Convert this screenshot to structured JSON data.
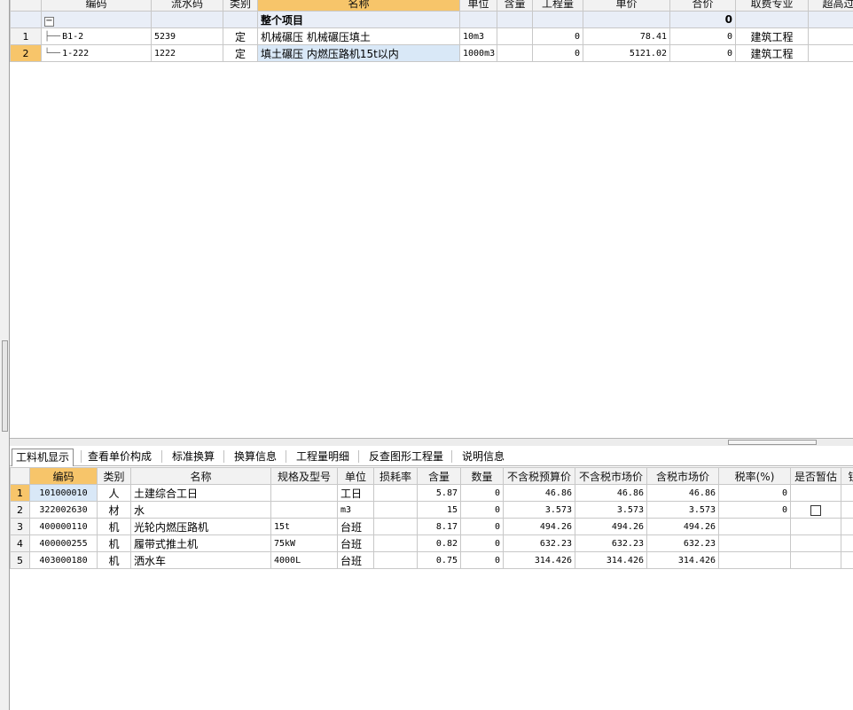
{
  "top_table": {
    "headers": [
      "编码",
      "流水码",
      "类别",
      "名称",
      "单位",
      "含量",
      "工程量",
      "单价",
      "合价",
      "取费专业",
      "超高过滤"
    ],
    "group_row": {
      "toggle": "−",
      "name": "整个项目",
      "total": "0"
    },
    "rows": [
      {
        "no": "1",
        "code": "B1-2",
        "serial": "5239",
        "type": "定",
        "name": "机械碾压 机械碾压填土",
        "unit": "10m3",
        "content": "",
        "qty": "0",
        "price": "78.41",
        "total": "0",
        "fee": "建筑工程"
      },
      {
        "no": "2",
        "code": "1-222",
        "serial": "1222",
        "type": "定",
        "name": "填土碾压 内燃压路机15t以内",
        "unit": "1000m3",
        "content": "",
        "qty": "0",
        "price": "5121.02",
        "total": "0",
        "fee": "建筑工程"
      }
    ]
  },
  "tabs": [
    "工料机显示",
    "查看单价构成",
    "标准换算",
    "换算信息",
    "工程量明细",
    "反查图形工程量",
    "说明信息"
  ],
  "bottom_table": {
    "headers": [
      "编码",
      "类别",
      "名称",
      "规格及型号",
      "单位",
      "损耗率",
      "含量",
      "数量",
      "不含税预算价",
      "不含税市场价",
      "含税市场价",
      "税率(%)",
      "是否暂估",
      "锁"
    ],
    "rows": [
      {
        "no": "1",
        "code": "101000010",
        "type": "人",
        "name": "土建综合工日",
        "spec": "",
        "unit": "工日",
        "loss": "",
        "content": "5.87",
        "qty": "0",
        "p1": "46.86",
        "p2": "46.86",
        "p3": "46.86",
        "tax": "0",
        "est": false
      },
      {
        "no": "2",
        "code": "322002630",
        "type": "材",
        "name": "水",
        "spec": "",
        "unit": "m3",
        "loss": "",
        "content": "15",
        "qty": "0",
        "p1": "3.573",
        "p2": "3.573",
        "p3": "3.573",
        "tax": "0",
        "est": true
      },
      {
        "no": "3",
        "code": "400000110",
        "type": "机",
        "name": "光轮内燃压路机",
        "spec": "15t",
        "unit": "台班",
        "loss": "",
        "content": "8.17",
        "qty": "0",
        "p1": "494.26",
        "p2": "494.26",
        "p3": "494.26",
        "tax": "",
        "est": false
      },
      {
        "no": "4",
        "code": "400000255",
        "type": "机",
        "name": "履带式推土机",
        "spec": "75kW",
        "unit": "台班",
        "loss": "",
        "content": "0.82",
        "qty": "0",
        "p1": "632.23",
        "p2": "632.23",
        "p3": "632.23",
        "tax": "",
        "est": false
      },
      {
        "no": "5",
        "code": "403000180",
        "type": "机",
        "name": "洒水车",
        "spec": "4000L",
        "unit": "台班",
        "loss": "",
        "content": "0.75",
        "qty": "0",
        "p1": "314.426",
        "p2": "314.426",
        "p3": "314.426",
        "tax": "",
        "est": false
      }
    ]
  }
}
